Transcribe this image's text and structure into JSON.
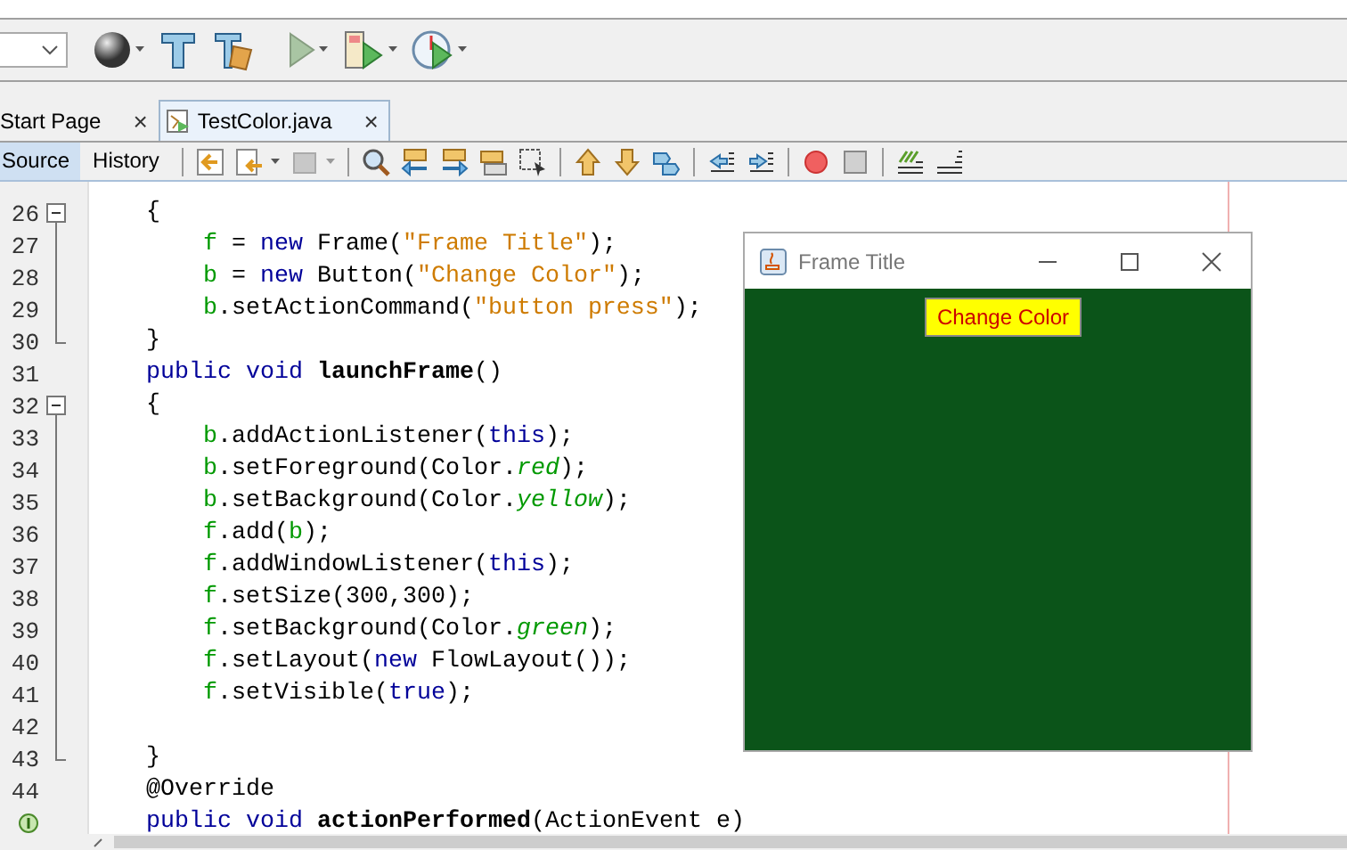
{
  "tabs": [
    {
      "label": "Start Page",
      "selected": false,
      "close": "×"
    },
    {
      "label": "TestColor.java",
      "selected": true,
      "close": "×"
    }
  ],
  "view_tabs": [
    {
      "label": "Source",
      "selected": true
    },
    {
      "label": "History",
      "selected": false
    }
  ],
  "code_lines": [
    {
      "number": "26",
      "kind": "start",
      "tokens": [
        {
          "t": "    {",
          "kind": "plain"
        }
      ]
    },
    {
      "number": "27",
      "kind": "body",
      "tokens": [
        {
          "t": "        f",
          "kind": "field"
        },
        {
          "t": " = ",
          "kind": "plain"
        },
        {
          "t": "new",
          "kind": "keyword"
        },
        {
          "t": " Frame(",
          "kind": "plain"
        },
        {
          "t": "\"Frame Title\"",
          "kind": "string"
        },
        {
          "t": ");",
          "kind": "plain"
        }
      ]
    },
    {
      "number": "28",
      "kind": "body",
      "tokens": [
        {
          "t": "        b",
          "kind": "field"
        },
        {
          "t": " = ",
          "kind": "plain"
        },
        {
          "t": "new",
          "kind": "keyword"
        },
        {
          "t": " Button(",
          "kind": "plain"
        },
        {
          "t": "\"Change Color\"",
          "kind": "string"
        },
        {
          "t": ");",
          "kind": "plain"
        }
      ]
    },
    {
      "number": "29",
      "kind": "body",
      "tokens": [
        {
          "t": "        b",
          "kind": "field"
        },
        {
          "t": ".setActionCommand(",
          "kind": "plain"
        },
        {
          "t": "\"button press\"",
          "kind": "string"
        },
        {
          "t": ");",
          "kind": "plain"
        }
      ]
    },
    {
      "number": "30",
      "kind": "end",
      "tokens": [
        {
          "t": "    }",
          "kind": "plain"
        }
      ]
    },
    {
      "number": "31",
      "kind": "plain",
      "tokens": [
        {
          "t": "    public",
          "kind": "keyword"
        },
        {
          "t": " void",
          "kind": "keyword"
        },
        {
          "t": " launchFrame",
          "kind": "method"
        },
        {
          "t": "()",
          "kind": "plain"
        }
      ]
    },
    {
      "number": "32",
      "kind": "start",
      "tokens": [
        {
          "t": "    {",
          "kind": "plain"
        }
      ]
    },
    {
      "number": "33",
      "kind": "body",
      "tokens": [
        {
          "t": "        b",
          "kind": "field"
        },
        {
          "t": ".addActionListener(",
          "kind": "plain"
        },
        {
          "t": "this",
          "kind": "keyword"
        },
        {
          "t": ");",
          "kind": "plain"
        }
      ]
    },
    {
      "number": "34",
      "kind": "body",
      "tokens": [
        {
          "t": "        b",
          "kind": "field"
        },
        {
          "t": ".setForeground(Color.",
          "kind": "plain"
        },
        {
          "t": "red",
          "kind": "static"
        },
        {
          "t": ");",
          "kind": "plain"
        }
      ]
    },
    {
      "number": "35",
      "kind": "body",
      "tokens": [
        {
          "t": "        b",
          "kind": "field"
        },
        {
          "t": ".setBackground(Color.",
          "kind": "plain"
        },
        {
          "t": "yellow",
          "kind": "static"
        },
        {
          "t": ");",
          "kind": "plain"
        }
      ]
    },
    {
      "number": "36",
      "kind": "body",
      "tokens": [
        {
          "t": "        f",
          "kind": "field"
        },
        {
          "t": ".add(",
          "kind": "plain"
        },
        {
          "t": "b",
          "kind": "field"
        },
        {
          "t": ");",
          "kind": "plain"
        }
      ]
    },
    {
      "number": "37",
      "kind": "body",
      "tokens": [
        {
          "t": "        f",
          "kind": "field"
        },
        {
          "t": ".addWindowListener(",
          "kind": "plain"
        },
        {
          "t": "this",
          "kind": "keyword"
        },
        {
          "t": ");",
          "kind": "plain"
        }
      ]
    },
    {
      "number": "38",
      "kind": "body",
      "tokens": [
        {
          "t": "        f",
          "kind": "field"
        },
        {
          "t": ".setSize(300,300);",
          "kind": "plain"
        }
      ]
    },
    {
      "number": "39",
      "kind": "body",
      "tokens": [
        {
          "t": "        f",
          "kind": "field"
        },
        {
          "t": ".setBackground(Color.",
          "kind": "plain"
        },
        {
          "t": "green",
          "kind": "static"
        },
        {
          "t": ");",
          "kind": "plain"
        }
      ]
    },
    {
      "number": "40",
      "kind": "body",
      "tokens": [
        {
          "t": "        f",
          "kind": "field"
        },
        {
          "t": ".setLayout(",
          "kind": "plain"
        },
        {
          "t": "new",
          "kind": "keyword"
        },
        {
          "t": " FlowLayout());",
          "kind": "plain"
        }
      ]
    },
    {
      "number": "41",
      "kind": "body",
      "tokens": [
        {
          "t": "        f",
          "kind": "field"
        },
        {
          "t": ".setVisible(",
          "kind": "plain"
        },
        {
          "t": "true",
          "kind": "keyword"
        },
        {
          "t": ");",
          "kind": "plain"
        }
      ]
    },
    {
      "number": "42",
      "kind": "body"
    },
    {
      "number": "43",
      "kind": "end",
      "tokens": [
        {
          "t": "    }",
          "kind": "plain"
        }
      ]
    },
    {
      "number": "44",
      "kind": "plain",
      "tokens": [
        {
          "t": "    @Override",
          "kind": "plain"
        }
      ]
    },
    {
      "kind": "implements",
      "tokens": [
        {
          "t": "    public",
          "kind": "keyword"
        },
        {
          "t": " void",
          "kind": "keyword"
        },
        {
          "t": " actionPerformed",
          "kind": "method"
        },
        {
          "t": "(ActionEvent e)",
          "kind": "plain"
        }
      ]
    }
  ],
  "frame_window": {
    "title": "Frame Title",
    "button": "Change Color"
  }
}
